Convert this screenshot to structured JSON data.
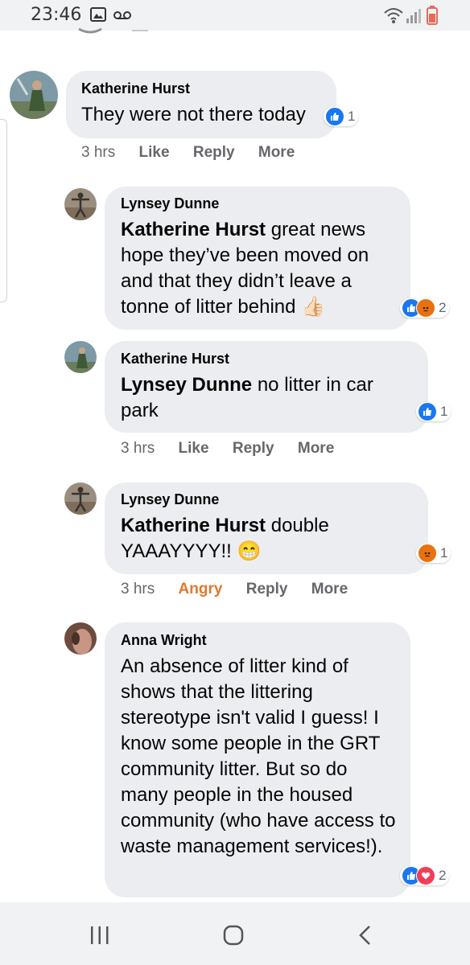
{
  "status_bar": {
    "time": "23:46",
    "icons": [
      "image-icon",
      "voicemail-icon",
      "wifi-icon",
      "signal-icon",
      "battery-icon"
    ]
  },
  "colors": {
    "like_blue": "#1877f2",
    "angry_orange": "#e9710f",
    "love_red": "#f33e58",
    "bubble_gray": "#ebedf0",
    "angry_text": "#e0792d"
  },
  "comments": [
    {
      "author": "Katherine Hurst",
      "text": "They were not there today",
      "reactions": [
        "like"
      ],
      "reaction_count": "1",
      "time": "3 hrs",
      "like_label": "Like",
      "reply_label": "Reply",
      "more_label": "More"
    },
    {
      "author": "Lynsey Dunne",
      "mention": "Katherine Hurst",
      "text": "great news hope they’ve been moved on and that they didn’t leave a tonne of litter behind",
      "emoji": "👍🏻",
      "reactions": [
        "like",
        "angry"
      ],
      "reaction_count": "2"
    },
    {
      "author": "Katherine Hurst",
      "mention": "Lynsey Dunne",
      "text": "no litter in car park",
      "reactions": [
        "like"
      ],
      "reaction_count": "1",
      "time": "3 hrs",
      "like_label": "Like",
      "reply_label": "Reply",
      "more_label": "More"
    },
    {
      "author": "Lynsey Dunne",
      "mention": "Katherine Hurst",
      "text": "double YAAAYYYY!!",
      "emoji": "😁",
      "reactions": [
        "angry"
      ],
      "reaction_count": "1",
      "time": "3 hrs",
      "like_label": "Angry",
      "reply_label": "Reply",
      "more_label": "More"
    },
    {
      "author": "Anna Wright",
      "text": "An absence of litter kind of shows that the littering stereotype isn't valid I guess! I know some people in the GRT community litter. But so do many people in the housed community (who have access to waste management services!).",
      "reactions": [
        "like",
        "love"
      ],
      "reaction_count": "2"
    }
  ],
  "nav": {
    "items": [
      "recent-apps",
      "home",
      "back"
    ]
  }
}
